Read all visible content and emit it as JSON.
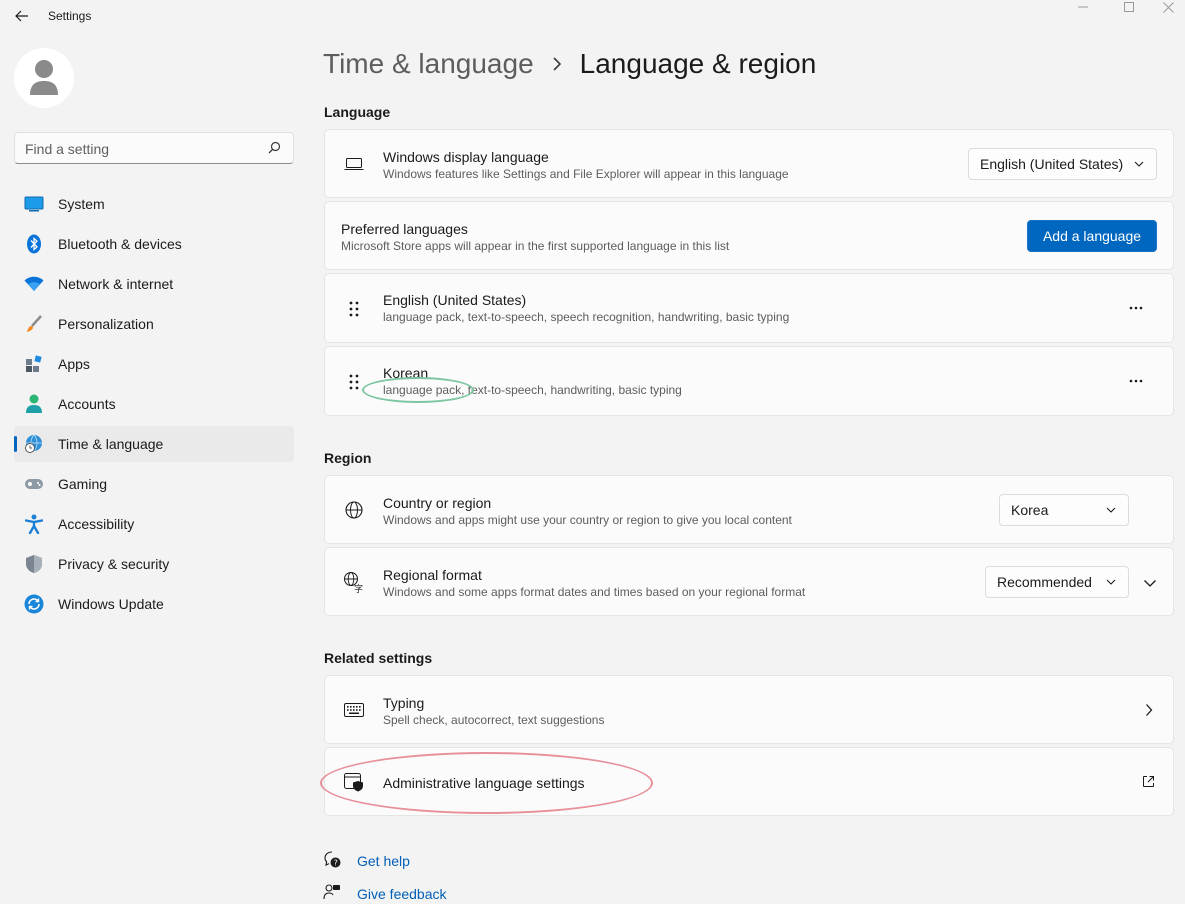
{
  "window": {
    "title": "Settings"
  },
  "account": {
    "avatar_icon": "person-icon"
  },
  "search": {
    "placeholder": "Find a setting",
    "icon": "search-icon"
  },
  "sidebar": {
    "items": [
      {
        "label": "System",
        "icon": "system-icon"
      },
      {
        "label": "Bluetooth & devices",
        "icon": "bluetooth-icon"
      },
      {
        "label": "Network & internet",
        "icon": "wifi-icon"
      },
      {
        "label": "Personalization",
        "icon": "brush-icon"
      },
      {
        "label": "Apps",
        "icon": "apps-icon"
      },
      {
        "label": "Accounts",
        "icon": "accounts-icon"
      },
      {
        "label": "Time & language",
        "icon": "globe-clock-icon",
        "active": true
      },
      {
        "label": "Gaming",
        "icon": "gamepad-icon"
      },
      {
        "label": "Accessibility",
        "icon": "accessibility-icon"
      },
      {
        "label": "Privacy & security",
        "icon": "shield-icon"
      },
      {
        "label": "Windows Update",
        "icon": "update-icon"
      }
    ]
  },
  "header": {
    "parent": "Time & language",
    "current": "Language & region"
  },
  "language": {
    "section_title": "Language",
    "display": {
      "title": "Windows display language",
      "subtitle": "Windows features like Settings and File Explorer will appear in this language",
      "value": "English (United States)"
    },
    "preferred": {
      "title": "Preferred languages",
      "subtitle": "Microsoft Store apps will appear in the first supported language in this list",
      "button": "Add a language"
    },
    "list": [
      {
        "name": "English (United States)",
        "features": "language pack, text-to-speech, speech recognition, handwriting, basic typing"
      },
      {
        "name": "Korean",
        "features": "language pack, text-to-speech, handwriting, basic typing"
      }
    ]
  },
  "region": {
    "section_title": "Region",
    "country": {
      "title": "Country or region",
      "subtitle": "Windows and apps might use your country or region to give you local content",
      "value": "Korea"
    },
    "format": {
      "title": "Regional format",
      "subtitle": "Windows and some apps format dates and times based on your regional format",
      "value": "Recommended"
    }
  },
  "related": {
    "section_title": "Related settings",
    "typing": {
      "title": "Typing",
      "subtitle": "Spell check, autocorrect, text suggestions"
    },
    "admin": {
      "title": "Administrative language settings"
    }
  },
  "footer": {
    "help": "Get help",
    "feedback": "Give feedback"
  },
  "colors": {
    "accent": "#0067c0",
    "annotation_green": "#7cc6a0",
    "annotation_red": "#e8909a"
  }
}
